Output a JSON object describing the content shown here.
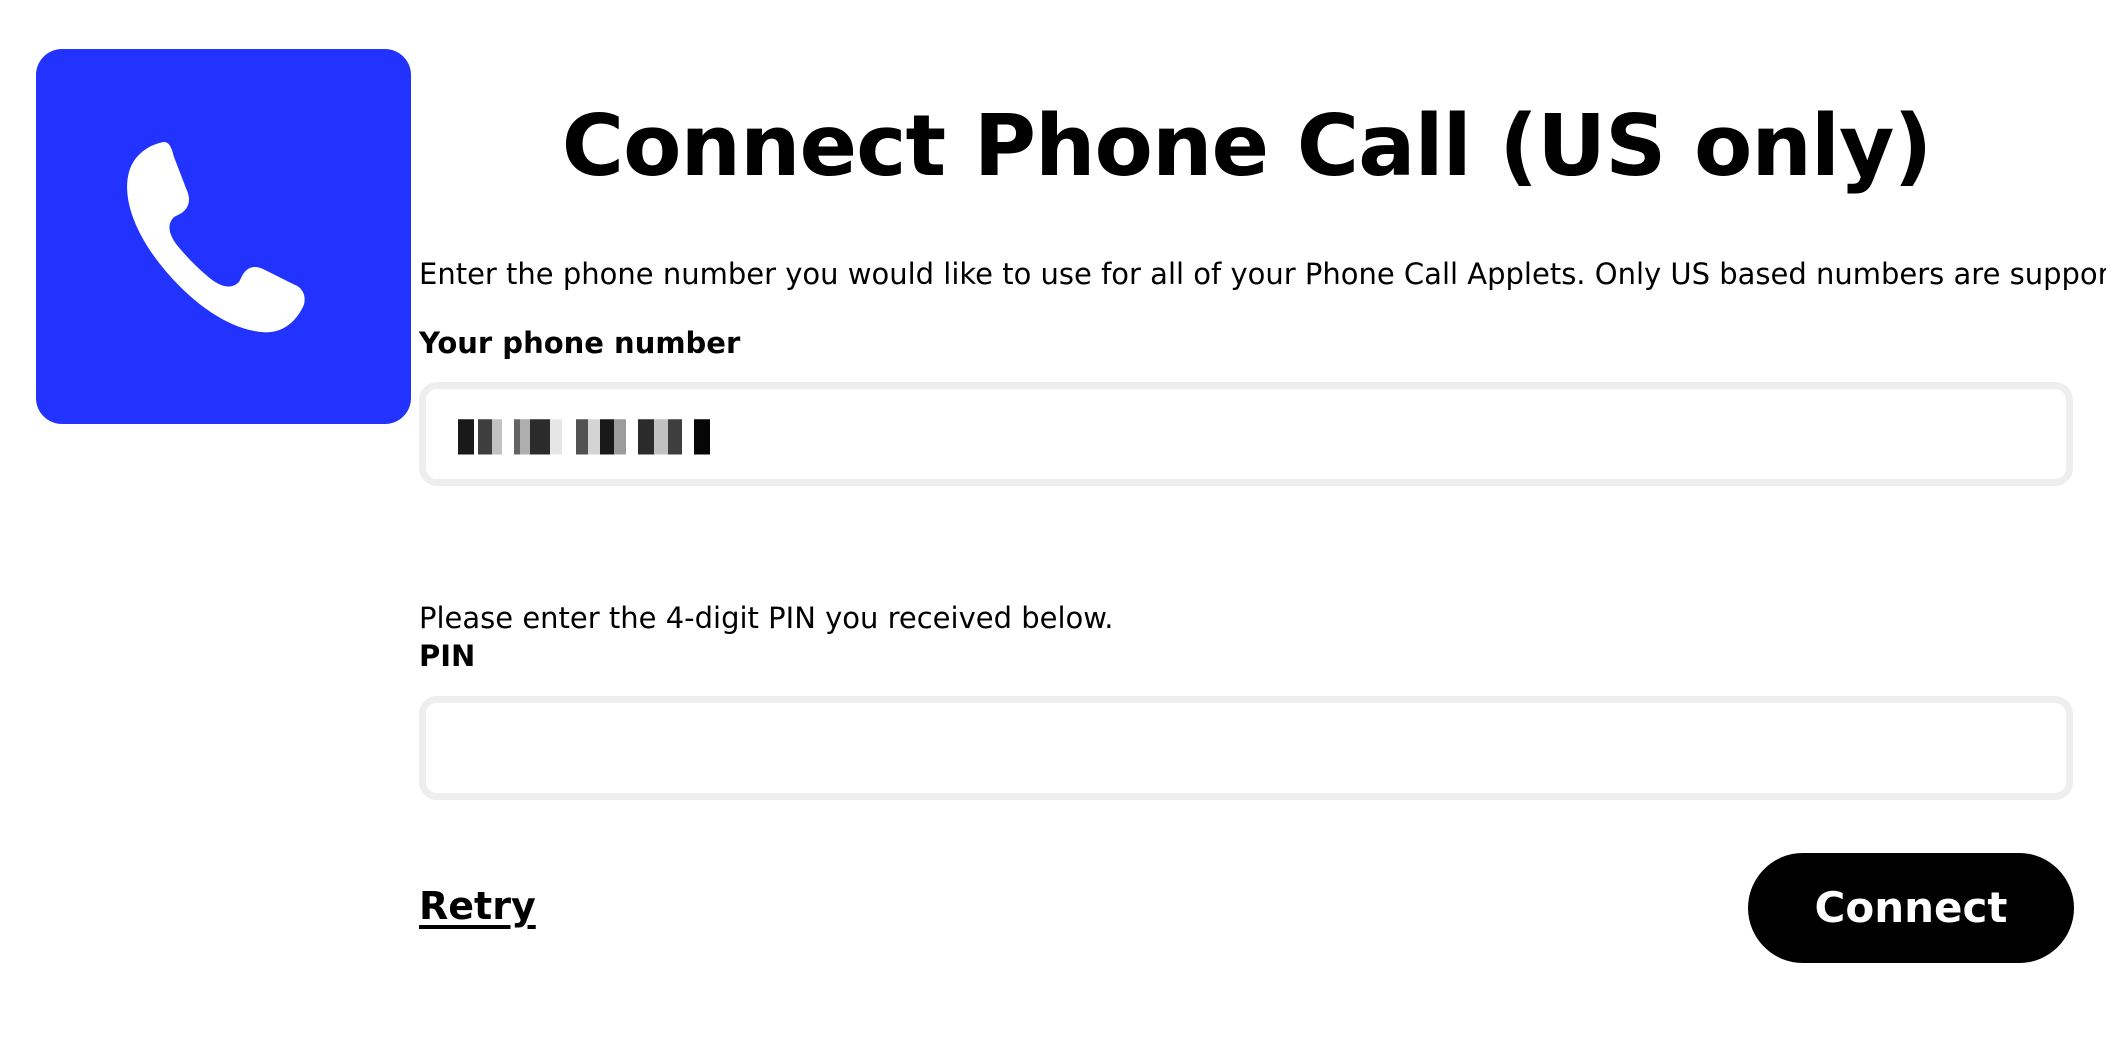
{
  "service": {
    "icon": "phone-icon",
    "brand_color": "#2233ff"
  },
  "page": {
    "title": "Connect Phone Call (US only)",
    "intro": "Enter the phone number you would like to use for all of your Phone Call Applets. Only US based numbers are supported."
  },
  "phone": {
    "label": "Your phone number",
    "value_state": "redacted (pixelated)"
  },
  "pin": {
    "instruction": "Please enter the 4-digit PIN you received below.",
    "label": "PIN",
    "value": ""
  },
  "actions": {
    "retry_label": "Retry",
    "connect_label": "Connect"
  }
}
